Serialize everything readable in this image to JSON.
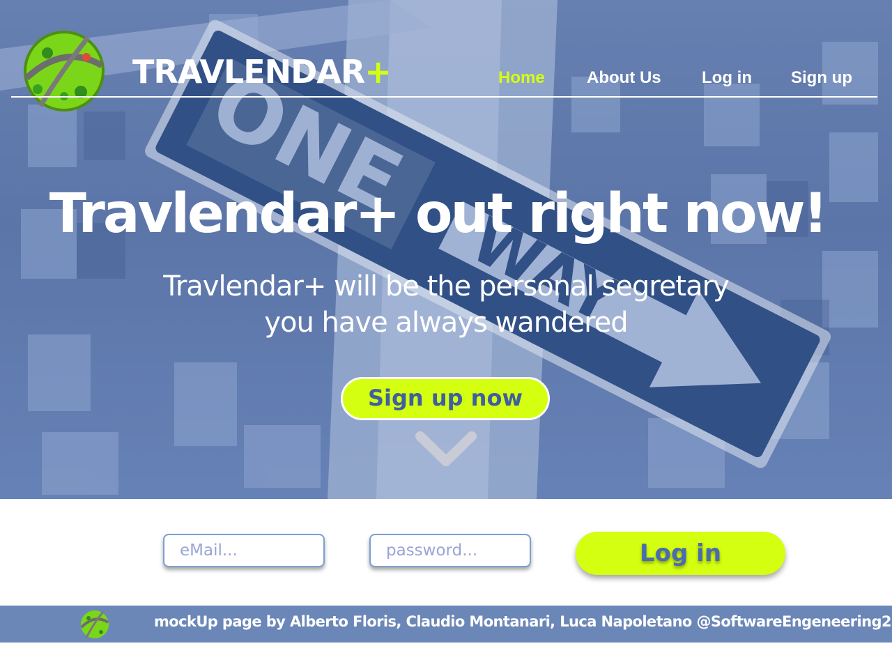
{
  "header": {
    "brand_name": "TRAVLENDAR",
    "brand_plus": "+",
    "nav": [
      "Home",
      "About Us",
      "Log in",
      "Sign up"
    ],
    "active_nav": "Home"
  },
  "hero": {
    "background_sign_text": [
      "ONE",
      "WAY"
    ],
    "headline": "Travlendar+ out right now!",
    "subtitle_line1": "Travlendar+ will be the personal  segretary",
    "subtitle_line2": "you have always wandered",
    "cta_label": "Sign up now",
    "scroll_icon": "chevron-down-icon"
  },
  "login": {
    "email_placeholder": "eMail...",
    "password_placeholder": "password...",
    "submit_label": "Log in"
  },
  "footer": {
    "credits": "mockUp page by Alberto Floris, Claudio Montanari, Luca Napoletano @SoftwareEngeneering2"
  },
  "colors": {
    "accent_lime": "#d4ff10",
    "footer_blue": "#6b87b8",
    "sign_navy": "#2b4a7e",
    "input_border": "#7b9fd2"
  }
}
